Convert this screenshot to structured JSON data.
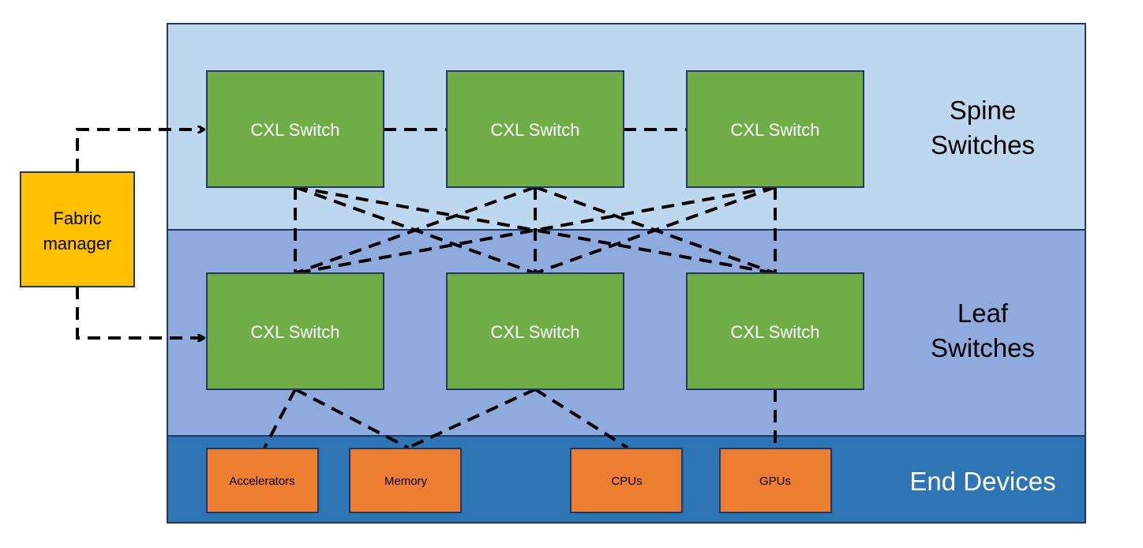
{
  "fabric_manager": {
    "line1": "Fabric",
    "line2": "manager"
  },
  "layers": {
    "spine": {
      "line1": "Spine",
      "line2": "Switches"
    },
    "leaf": {
      "line1": "Leaf",
      "line2": "Switches"
    },
    "end": {
      "label": "End Devices"
    }
  },
  "spine_switches": [
    "CXL Switch",
    "CXL Switch",
    "CXL Switch"
  ],
  "leaf_switches": [
    "CXL Switch",
    "CXL Switch",
    "CXL Switch"
  ],
  "end_devices": [
    "Accelerators",
    "Memory",
    "CPUs",
    "GPUs"
  ],
  "colors": {
    "spine_band": "#bdd7ee",
    "leaf_band": "#8faadc",
    "end_band": "#2e75b6",
    "switch": "#70ad47",
    "device": "#ed7d31",
    "fabric_manager": "#ffc000"
  }
}
